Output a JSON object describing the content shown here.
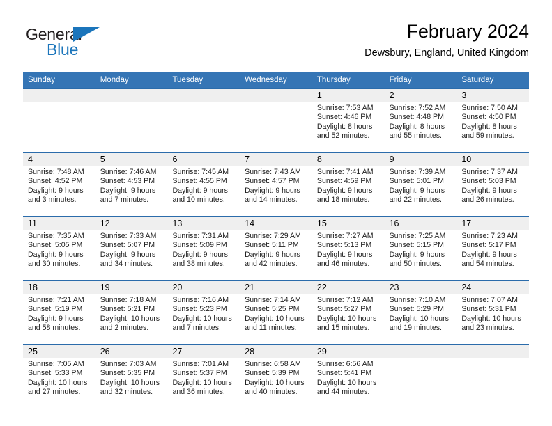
{
  "logo": {
    "word1": "General",
    "word2": "Blue",
    "triangle_color": "#1b75bb",
    "text_color": "#231f20"
  },
  "header": {
    "title": "February 2024",
    "subtitle": "Dewsbury, England, United Kingdom"
  },
  "theme": {
    "header_blue": "#3575b5",
    "divider_blue": "#2b6cab",
    "datebar_gray": "#efefef"
  },
  "weekdays": [
    "Sunday",
    "Monday",
    "Tuesday",
    "Wednesday",
    "Thursday",
    "Friday",
    "Saturday"
  ],
  "weeks": [
    [
      {
        "day": "",
        "sunrise": "",
        "sunset": "",
        "daylight1": "",
        "daylight2": ""
      },
      {
        "day": "",
        "sunrise": "",
        "sunset": "",
        "daylight1": "",
        "daylight2": ""
      },
      {
        "day": "",
        "sunrise": "",
        "sunset": "",
        "daylight1": "",
        "daylight2": ""
      },
      {
        "day": "",
        "sunrise": "",
        "sunset": "",
        "daylight1": "",
        "daylight2": ""
      },
      {
        "day": "1",
        "sunrise": "Sunrise: 7:53 AM",
        "sunset": "Sunset: 4:46 PM",
        "daylight1": "Daylight: 8 hours",
        "daylight2": "and 52 minutes."
      },
      {
        "day": "2",
        "sunrise": "Sunrise: 7:52 AM",
        "sunset": "Sunset: 4:48 PM",
        "daylight1": "Daylight: 8 hours",
        "daylight2": "and 55 minutes."
      },
      {
        "day": "3",
        "sunrise": "Sunrise: 7:50 AM",
        "sunset": "Sunset: 4:50 PM",
        "daylight1": "Daylight: 8 hours",
        "daylight2": "and 59 minutes."
      }
    ],
    [
      {
        "day": "4",
        "sunrise": "Sunrise: 7:48 AM",
        "sunset": "Sunset: 4:52 PM",
        "daylight1": "Daylight: 9 hours",
        "daylight2": "and 3 minutes."
      },
      {
        "day": "5",
        "sunrise": "Sunrise: 7:46 AM",
        "sunset": "Sunset: 4:53 PM",
        "daylight1": "Daylight: 9 hours",
        "daylight2": "and 7 minutes."
      },
      {
        "day": "6",
        "sunrise": "Sunrise: 7:45 AM",
        "sunset": "Sunset: 4:55 PM",
        "daylight1": "Daylight: 9 hours",
        "daylight2": "and 10 minutes."
      },
      {
        "day": "7",
        "sunrise": "Sunrise: 7:43 AM",
        "sunset": "Sunset: 4:57 PM",
        "daylight1": "Daylight: 9 hours",
        "daylight2": "and 14 minutes."
      },
      {
        "day": "8",
        "sunrise": "Sunrise: 7:41 AM",
        "sunset": "Sunset: 4:59 PM",
        "daylight1": "Daylight: 9 hours",
        "daylight2": "and 18 minutes."
      },
      {
        "day": "9",
        "sunrise": "Sunrise: 7:39 AM",
        "sunset": "Sunset: 5:01 PM",
        "daylight1": "Daylight: 9 hours",
        "daylight2": "and 22 minutes."
      },
      {
        "day": "10",
        "sunrise": "Sunrise: 7:37 AM",
        "sunset": "Sunset: 5:03 PM",
        "daylight1": "Daylight: 9 hours",
        "daylight2": "and 26 minutes."
      }
    ],
    [
      {
        "day": "11",
        "sunrise": "Sunrise: 7:35 AM",
        "sunset": "Sunset: 5:05 PM",
        "daylight1": "Daylight: 9 hours",
        "daylight2": "and 30 minutes."
      },
      {
        "day": "12",
        "sunrise": "Sunrise: 7:33 AM",
        "sunset": "Sunset: 5:07 PM",
        "daylight1": "Daylight: 9 hours",
        "daylight2": "and 34 minutes."
      },
      {
        "day": "13",
        "sunrise": "Sunrise: 7:31 AM",
        "sunset": "Sunset: 5:09 PM",
        "daylight1": "Daylight: 9 hours",
        "daylight2": "and 38 minutes."
      },
      {
        "day": "14",
        "sunrise": "Sunrise: 7:29 AM",
        "sunset": "Sunset: 5:11 PM",
        "daylight1": "Daylight: 9 hours",
        "daylight2": "and 42 minutes."
      },
      {
        "day": "15",
        "sunrise": "Sunrise: 7:27 AM",
        "sunset": "Sunset: 5:13 PM",
        "daylight1": "Daylight: 9 hours",
        "daylight2": "and 46 minutes."
      },
      {
        "day": "16",
        "sunrise": "Sunrise: 7:25 AM",
        "sunset": "Sunset: 5:15 PM",
        "daylight1": "Daylight: 9 hours",
        "daylight2": "and 50 minutes."
      },
      {
        "day": "17",
        "sunrise": "Sunrise: 7:23 AM",
        "sunset": "Sunset: 5:17 PM",
        "daylight1": "Daylight: 9 hours",
        "daylight2": "and 54 minutes."
      }
    ],
    [
      {
        "day": "18",
        "sunrise": "Sunrise: 7:21 AM",
        "sunset": "Sunset: 5:19 PM",
        "daylight1": "Daylight: 9 hours",
        "daylight2": "and 58 minutes."
      },
      {
        "day": "19",
        "sunrise": "Sunrise: 7:18 AM",
        "sunset": "Sunset: 5:21 PM",
        "daylight1": "Daylight: 10 hours",
        "daylight2": "and 2 minutes."
      },
      {
        "day": "20",
        "sunrise": "Sunrise: 7:16 AM",
        "sunset": "Sunset: 5:23 PM",
        "daylight1": "Daylight: 10 hours",
        "daylight2": "and 7 minutes."
      },
      {
        "day": "21",
        "sunrise": "Sunrise: 7:14 AM",
        "sunset": "Sunset: 5:25 PM",
        "daylight1": "Daylight: 10 hours",
        "daylight2": "and 11 minutes."
      },
      {
        "day": "22",
        "sunrise": "Sunrise: 7:12 AM",
        "sunset": "Sunset: 5:27 PM",
        "daylight1": "Daylight: 10 hours",
        "daylight2": "and 15 minutes."
      },
      {
        "day": "23",
        "sunrise": "Sunrise: 7:10 AM",
        "sunset": "Sunset: 5:29 PM",
        "daylight1": "Daylight: 10 hours",
        "daylight2": "and 19 minutes."
      },
      {
        "day": "24",
        "sunrise": "Sunrise: 7:07 AM",
        "sunset": "Sunset: 5:31 PM",
        "daylight1": "Daylight: 10 hours",
        "daylight2": "and 23 minutes."
      }
    ],
    [
      {
        "day": "25",
        "sunrise": "Sunrise: 7:05 AM",
        "sunset": "Sunset: 5:33 PM",
        "daylight1": "Daylight: 10 hours",
        "daylight2": "and 27 minutes."
      },
      {
        "day": "26",
        "sunrise": "Sunrise: 7:03 AM",
        "sunset": "Sunset: 5:35 PM",
        "daylight1": "Daylight: 10 hours",
        "daylight2": "and 32 minutes."
      },
      {
        "day": "27",
        "sunrise": "Sunrise: 7:01 AM",
        "sunset": "Sunset: 5:37 PM",
        "daylight1": "Daylight: 10 hours",
        "daylight2": "and 36 minutes."
      },
      {
        "day": "28",
        "sunrise": "Sunrise: 6:58 AM",
        "sunset": "Sunset: 5:39 PM",
        "daylight1": "Daylight: 10 hours",
        "daylight2": "and 40 minutes."
      },
      {
        "day": "29",
        "sunrise": "Sunrise: 6:56 AM",
        "sunset": "Sunset: 5:41 PM",
        "daylight1": "Daylight: 10 hours",
        "daylight2": "and 44 minutes."
      },
      {
        "day": "",
        "sunrise": "",
        "sunset": "",
        "daylight1": "",
        "daylight2": ""
      },
      {
        "day": "",
        "sunrise": "",
        "sunset": "",
        "daylight1": "",
        "daylight2": ""
      }
    ]
  ]
}
